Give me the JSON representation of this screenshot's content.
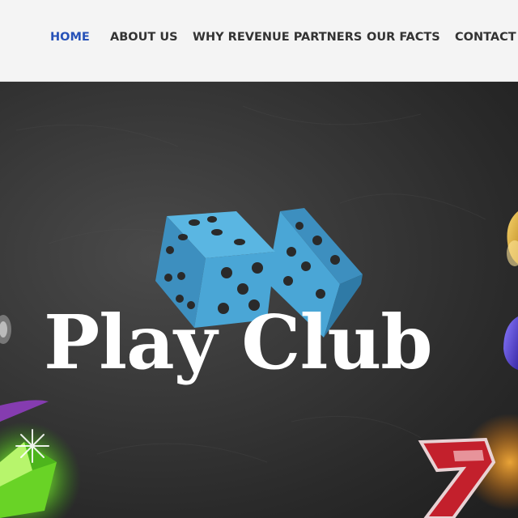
{
  "nav": {
    "items": [
      {
        "label": "HOME",
        "active": true
      },
      {
        "label": "ABOUT US",
        "active": false
      },
      {
        "label": "WHY REVENUE PARTNERS",
        "active": false
      },
      {
        "label": "OUR FACTS",
        "active": false
      },
      {
        "label": "CONTACT U",
        "active": false
      }
    ],
    "active_color": "#2752b8",
    "text_color": "#333333"
  },
  "hero": {
    "logo_text": "Play Club",
    "logo_color": "#ffffff",
    "dice_color": "#4aa6d6",
    "icons": [
      "dice-icon",
      "gem-icon",
      "bell-icon",
      "plum-icon",
      "seven-icon",
      "cherry-icon"
    ]
  }
}
